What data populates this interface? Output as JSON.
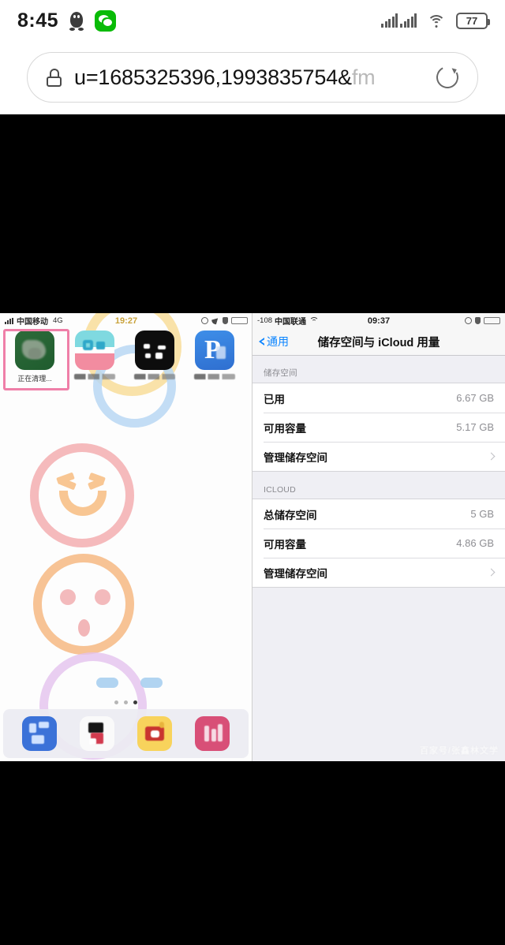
{
  "android": {
    "status_bar": {
      "clock": "8:45",
      "icons": [
        "qq-icon",
        "wechat-icon"
      ],
      "signal": "signal-bars-dual",
      "wifi": "wifi-icon",
      "battery_percent": "77"
    },
    "url_bar": {
      "lock_icon": "lock-icon",
      "url_visible": "u=1685325396,1993835754&",
      "url_faded": "fm",
      "refresh_icon": "refresh-icon"
    }
  },
  "embedded_screenshot": {
    "left_pane": {
      "type": "ios-home-screen",
      "status_bar": {
        "carrier": "中国移动",
        "network": "4G",
        "time": "19:27",
        "right_icons": [
          "alarm-icon",
          "location-arrow-icon",
          "rotation-lock-icon"
        ],
        "battery_color": "#4cd764"
      },
      "apps": [
        {
          "label": "正在清理...",
          "icon": "cleaning-app-icon",
          "highlighted": true
        },
        {
          "label": "",
          "icon": "teal-pink-app-icon",
          "highlighted": false
        },
        {
          "label": "",
          "icon": "black-app-icon",
          "highlighted": false
        },
        {
          "label": "",
          "icon": "blue-p-app-icon",
          "highlighted": false
        }
      ],
      "page_dots": {
        "count": 3,
        "active_index": 2
      },
      "dock": [
        {
          "icon": "dock-blue-icon"
        },
        {
          "icon": "dock-white-icon"
        },
        {
          "icon": "dock-yellow-icon"
        },
        {
          "icon": "dock-pink-icon"
        }
      ]
    },
    "right_pane": {
      "type": "ios-settings-storage",
      "status_bar": {
        "lead": "-108",
        "carrier": "中国联通",
        "wifi": "wifi-icon",
        "time": "09:37",
        "right_icons": [
          "alarm-icon",
          "rotation-lock-icon"
        ],
        "battery_color": "#1c1c1c"
      },
      "nav": {
        "back_label": "通用",
        "title": "储存空间与 iCloud 用量"
      },
      "sections": [
        {
          "header": "储存空间",
          "rows": [
            {
              "label": "已用",
              "value": "6.67 GB",
              "chevron": false
            },
            {
              "label": "可用容量",
              "value": "5.17 GB",
              "chevron": false
            },
            {
              "label": "管理储存空间",
              "value": "",
              "chevron": true
            }
          ]
        },
        {
          "header": "ICLOUD",
          "rows": [
            {
              "label": "总储存空间",
              "value": "5 GB",
              "chevron": false
            },
            {
              "label": "可用容量",
              "value": "4.86 GB",
              "chevron": false
            },
            {
              "label": "管理储存空间",
              "value": "",
              "chevron": true
            }
          ]
        }
      ],
      "watermark": "百家号/张鑫林文学"
    }
  }
}
